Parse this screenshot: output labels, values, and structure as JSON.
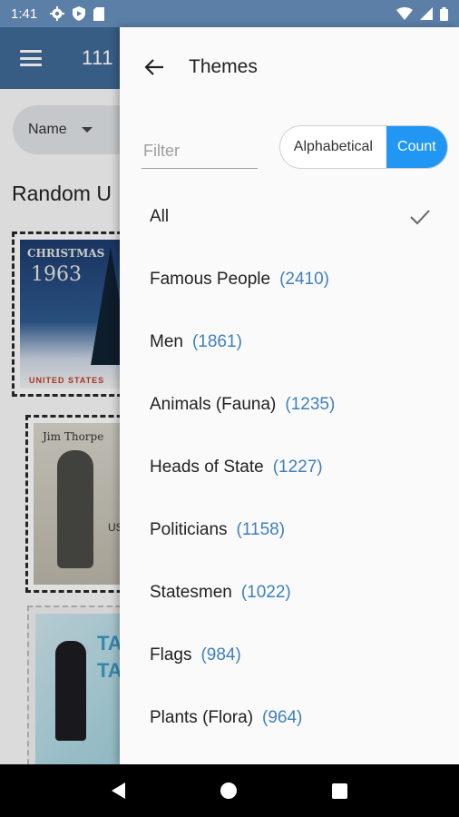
{
  "status_bar": {
    "time": "1:41",
    "icons_left": [
      "settings-icon",
      "shield-icon",
      "sd-card-icon"
    ],
    "icons_right": [
      "wifi-icon",
      "cell-signal-icon",
      "battery-icon"
    ]
  },
  "background": {
    "app_title": "111",
    "sort_chip": {
      "label": "Name"
    },
    "heading": "Random U",
    "stamps": [
      {
        "top_text": "CHRISTMAS",
        "year": "1963",
        "bottom_text": "UNITED STATES"
      },
      {
        "top_text": "Jim Thorpe",
        "country": "USA"
      },
      {
        "text": "TAP TAP"
      }
    ]
  },
  "drawer": {
    "title": "Themes",
    "filter": {
      "placeholder": "Filter",
      "value": ""
    },
    "sort_toggle": {
      "options": [
        "Alphabetical",
        "Count"
      ],
      "selected": "Count"
    },
    "items": [
      {
        "label": "All",
        "count": "",
        "selected": true
      },
      {
        "label": "Famous People",
        "count": "(2410)"
      },
      {
        "label": "Men",
        "count": "(1861)"
      },
      {
        "label": "Animals (Fauna)",
        "count": "(1235)"
      },
      {
        "label": "Heads of State",
        "count": "(1227)"
      },
      {
        "label": "Politicians",
        "count": "(1158)"
      },
      {
        "label": "Statesmen",
        "count": "(1022)"
      },
      {
        "label": "Flags",
        "count": "(984)"
      },
      {
        "label": "Plants (Flora)",
        "count": "(964)"
      }
    ]
  },
  "colors": {
    "status_bar": "#5b7fa6",
    "app_bar": "#3f6a97",
    "accent": "#2196f3",
    "count_text": "#3f7fc0"
  },
  "nav_bar": {
    "icons": [
      "back-icon",
      "home-icon",
      "recents-icon"
    ]
  }
}
